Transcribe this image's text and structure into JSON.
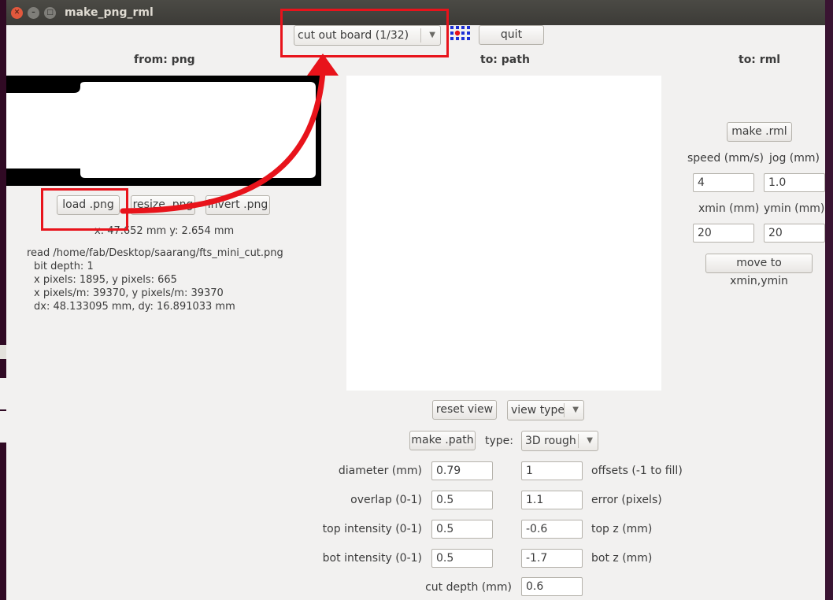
{
  "window": {
    "title": "make_png_rml"
  },
  "toolbar": {
    "process_select": "cut out board (1/32)",
    "quit_label": "quit",
    "grid_icon": "blue-red-dot-grid-icon"
  },
  "png_panel": {
    "heading": "from: png",
    "load_label": "load .png",
    "resize_label": "resize .png",
    "invert_label": "invert .png",
    "coords": "x: 47.652 mm  y: 2.654 mm",
    "info": [
      "read /home/fab/Desktop/saarang/fts_mini_cut.png",
      "  bit depth: 1",
      "  x pixels: 1895, y pixels: 665",
      "  x pixels/m: 39370, y pixels/m: 39370",
      "  dx: 48.133095 mm, dy: 16.891033 mm"
    ]
  },
  "path_panel": {
    "heading": "to: path",
    "reset_view_label": "reset view",
    "view_type_select": "view type",
    "make_path_label": "make .path",
    "type_label": "type:",
    "type_select": "3D rough",
    "diameter_label": "diameter (mm)",
    "diameter_value": "0.79",
    "offsets_label": "offsets (-1 to fill)",
    "offsets_value": "1",
    "overlap_label": "overlap (0-1)",
    "overlap_value": "0.5",
    "error_label": "error (pixels)",
    "error_value": "1.1",
    "top_intensity_label": "top intensity (0-1)",
    "top_intensity_value": "0.5",
    "top_z_label": "top z (mm)",
    "top_z_value": "-0.6",
    "bot_intensity_label": "bot intensity (0-1)",
    "bot_intensity_value": "0.5",
    "bot_z_label": "bot z (mm)",
    "bot_z_value": "-1.7",
    "cut_depth_label": "cut depth (mm)",
    "cut_depth_value": "0.6"
  },
  "rml_panel": {
    "heading": "to: rml",
    "make_rml_label": "make .rml",
    "speed_label": "speed (mm/s)",
    "speed_value": "4",
    "jog_label": "jog (mm)",
    "jog_value": "1.0",
    "xmin_label": "xmin (mm)",
    "xmin_value": "20",
    "ymin_label": "ymin (mm)",
    "ymin_value": "20",
    "move_label": "move to xmin,ymin"
  },
  "colors": {
    "annotation_red": "#e8131b",
    "window_bg": "#f2f1f0",
    "titlebar": "#3c3b37"
  }
}
